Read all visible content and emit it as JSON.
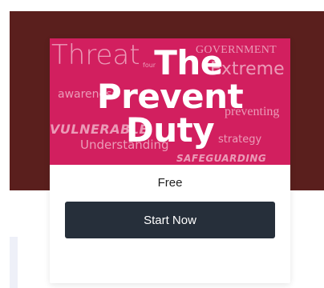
{
  "course": {
    "title_lines": [
      "The",
      "Prevent",
      "Duty"
    ],
    "background_words": {
      "threat": "Threat",
      "government": "GOVERNMENT",
      "extreme": "Extreme",
      "awareness": "awareness",
      "preventing": "preventing",
      "vulnerable": "VULNERABLE",
      "understanding": "Understanding",
      "strategy": "strategy",
      "safeguarding": "SAFEGUARDING",
      "small": "four"
    },
    "price": "Free",
    "start_label": "Start Now"
  },
  "colors": {
    "hero_band": "#5a1f1d",
    "thumbnail": "#d21f5f",
    "button": "#262f3a"
  }
}
